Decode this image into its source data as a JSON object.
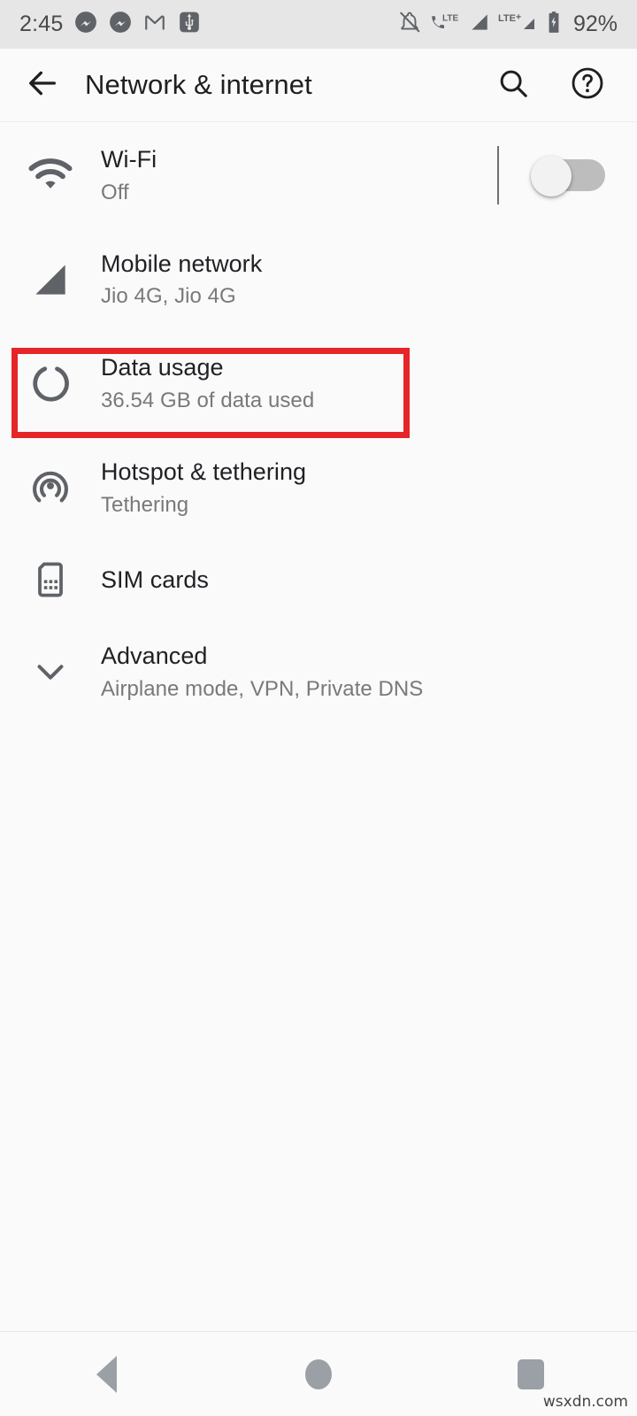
{
  "status_bar": {
    "clock": "2:45",
    "battery_percent": "92%",
    "left_icons": [
      "messenger-icon",
      "messenger-icon",
      "gmail-icon",
      "usb-icon"
    ],
    "right_icons": [
      "notifications-muted-icon",
      "call-lte-icon",
      "signal-bar-icon",
      "lte-plus-icon",
      "signal-bar-icon",
      "battery-charging-icon"
    ],
    "background": "#e6e6e6"
  },
  "app_bar": {
    "back_label": "back-arrow",
    "title": "Network & internet",
    "actions": [
      "search-icon",
      "help-icon"
    ]
  },
  "settings_list": [
    {
      "icon": "wifi-icon",
      "title": "Wi-Fi",
      "subtitle": "Off",
      "has_toggle": true,
      "toggle_on": false
    },
    {
      "icon": "mobile-network-signal-icon",
      "title": "Mobile network",
      "subtitle": "Jio 4G, Jio 4G",
      "has_toggle": false
    },
    {
      "icon": "data-usage-ring-icon",
      "title": "Data usage",
      "subtitle": "36.54 GB of data used",
      "has_toggle": false,
      "highlighted": true
    },
    {
      "icon": "hotspot-icon",
      "title": "Hotspot & tethering",
      "subtitle": "Tethering",
      "has_toggle": false
    },
    {
      "icon": "sim-card-icon",
      "title": "SIM cards",
      "subtitle": "",
      "has_toggle": false
    },
    {
      "icon": "chevron-down-icon",
      "title": "Advanced",
      "subtitle": "Airplane mode, VPN, Private DNS",
      "has_toggle": false
    }
  ],
  "annotation": {
    "color": "#e52528",
    "target": "Data usage"
  },
  "nav_bar": {
    "buttons": [
      "back-triangle-icon",
      "home-circle-icon",
      "recents-square-icon"
    ]
  },
  "watermark": "wsxdn.com"
}
